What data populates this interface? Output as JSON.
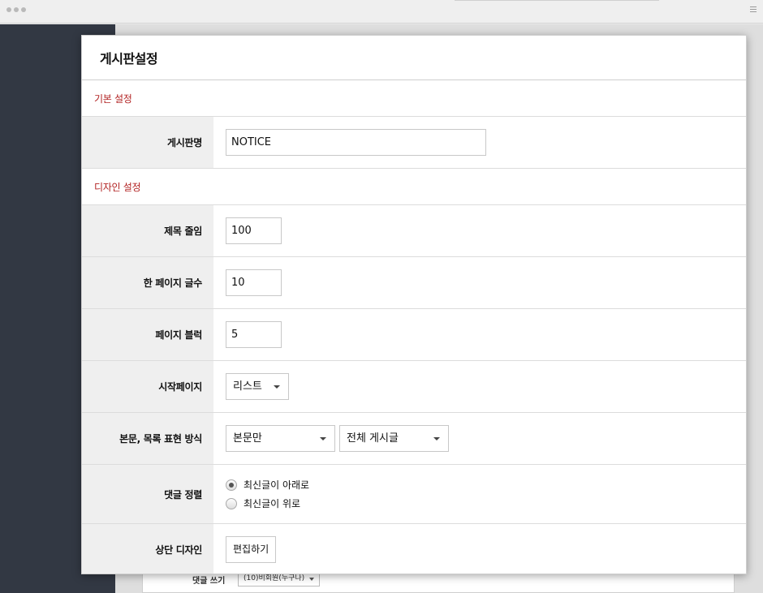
{
  "modal": {
    "title": "게시판설정"
  },
  "sections": {
    "basic": "기본 설정",
    "design": "디자인 설정"
  },
  "fields": {
    "board_name": {
      "label": "게시판명",
      "value": "NOTICE"
    },
    "title_length": {
      "label": "제목 줄임",
      "value": "100"
    },
    "posts_per_page": {
      "label": "한 페이지 글수",
      "value": "10"
    },
    "page_block": {
      "label": "페이지 블럭",
      "value": "5"
    },
    "start_page": {
      "label": "시작페이지",
      "selected": "리스트"
    },
    "display_mode": {
      "label": "본문, 목록 표현 방식",
      "body_selected": "본문만",
      "list_selected": "전체 게시글"
    },
    "comment_sort": {
      "label": "댓글 정렬",
      "options": [
        "최신글이 아래로",
        "최신글이 위로"
      ],
      "selected_index": 0
    },
    "top_design": {
      "label": "상단 디자인",
      "button": "편집하기"
    }
  },
  "background": {
    "comment_write_label": "댓글 쓰기",
    "comment_write_selected": "(10)비회원(누구나)"
  }
}
